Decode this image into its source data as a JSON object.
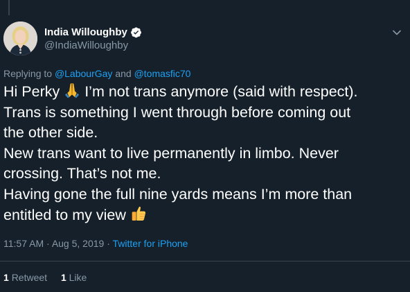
{
  "author": {
    "display_name": "India Willoughby",
    "handle": "@IndiaWilloughby",
    "verified": true,
    "avatar_icon": "profile-photo"
  },
  "reply": {
    "prefix": "Replying to",
    "user1": "@LabourGay",
    "joiner": "and",
    "user2": "@tomasfic70"
  },
  "tweet": {
    "line1_a": "Hi Perky",
    "line1_b": "I’m not trans anymore (said with respect).",
    "line2": "Trans is something I went through before coming out",
    "line3": "the other side.",
    "line4": "New trans want to live permanently in limbo. Never",
    "line5": "crossing. That’s not me.",
    "line6": "Having gone the full nine yards means I’m more than",
    "line7": "entitled to my view",
    "emoji1": "folded-hands-icon",
    "emoji2": "thumbs-up-icon"
  },
  "meta": {
    "time": "11:57 AM",
    "sep1": "·",
    "date": "Aug 5, 2019",
    "sep2": "·",
    "source": "Twitter for iPhone"
  },
  "stats": {
    "retweets_count": "1",
    "retweets_label": "Retweet",
    "likes_count": "1",
    "likes_label": "Like"
  },
  "colors": {
    "background": "#15202b",
    "text": "#ffffff",
    "secondary": "#8899a6",
    "link": "#1da1f2",
    "divider": "#38444d"
  }
}
